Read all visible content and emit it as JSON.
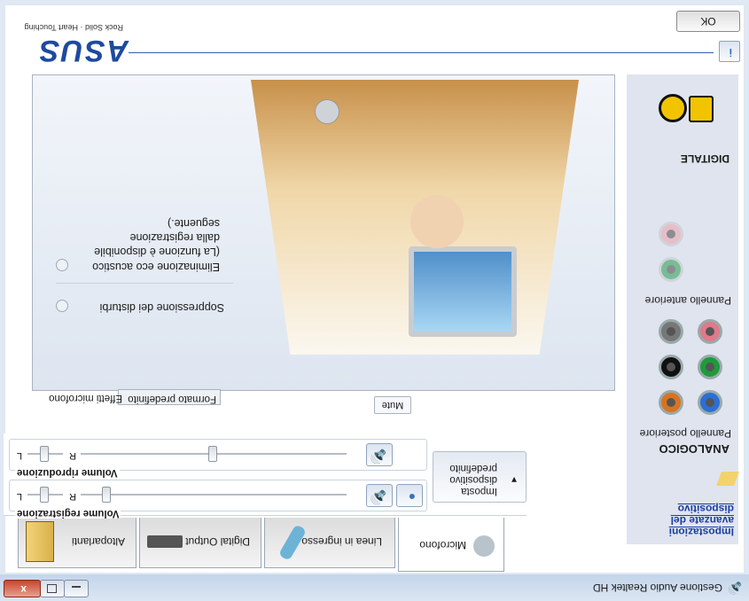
{
  "window": {
    "title": "Gestione Audio Realtek HD",
    "minimize_label": "",
    "maximize_label": "",
    "close_label": "x"
  },
  "tabs": [
    {
      "label": "Altoparlanti"
    },
    {
      "label": "Digital Output"
    },
    {
      "label": "Linea in ingresso"
    },
    {
      "label": "Microfono"
    }
  ],
  "recording": {
    "group_label": "Volume registrazione",
    "left": "L",
    "right": "R",
    "balance": 0.5,
    "volume": 0.1
  },
  "playback": {
    "group_label": "Volume riproduzione",
    "left": "L",
    "right": "R",
    "balance": 0.5,
    "volume": 0.5
  },
  "default_device": {
    "label_line1": "Imposta",
    "label_line2": "dispositivo",
    "label_line3": "predefinito"
  },
  "subtabs": {
    "effects": "Effetti microfono",
    "format": "Formato predefinito"
  },
  "effects": {
    "noise": "Soppressione dei disturbi",
    "echo": "Eliminazione eco acustico",
    "echo_note1": "(La funzione è disponibile",
    "echo_note2": "dalla registrazione",
    "echo_note3": "seguente.)"
  },
  "mute_label": "Mute",
  "sidebar": {
    "advanced1": "Impostazioni",
    "advanced2": "avanzate del",
    "advanced3": "dispositivo",
    "analog": "ANALOGICO",
    "rear_panel": "Pannello posteriore",
    "front_panel": "Pannello anteriore",
    "digital": "DIGITALE"
  },
  "header": {
    "brand": "ASUS",
    "slogan": "Rock Solid · Heart Touching",
    "ok_label": "OK",
    "info_label": "i"
  },
  "colors": {
    "rear_jacks": [
      "#2b6fd6",
      "#d9731f",
      "#1e9b3a",
      "#111111",
      "#e07a8a",
      "#777777"
    ],
    "front_jacks": [
      "#35a35a",
      "#e9a6b0"
    ]
  }
}
